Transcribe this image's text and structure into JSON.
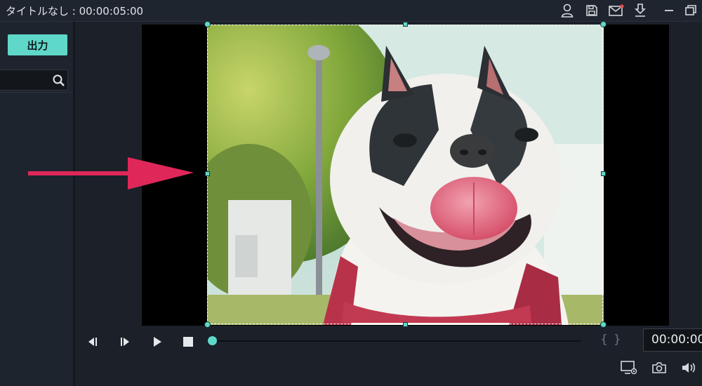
{
  "window": {
    "title": "タイトルなし : 00:00:05:00",
    "icons": [
      "account-icon",
      "save-icon",
      "mail-icon",
      "download-icon",
      "minimize-icon",
      "restore-icon"
    ],
    "notification_color": "#e84a4a"
  },
  "left_panel": {
    "export_label": "出力",
    "search": {
      "value": "",
      "placeholder": ""
    }
  },
  "preview": {
    "subject": "dog-photo",
    "arrow_color": "#e0275a",
    "accent": "#5fd8c9"
  },
  "playback": {
    "controls": [
      "previous-frame",
      "next-frame",
      "play",
      "stop"
    ],
    "mark_in": "{",
    "mark_out": "}",
    "timecode": "00:00:00",
    "progress": 0
  },
  "bottom_icons": [
    "display-settings-icon",
    "snapshot-icon",
    "volume-icon"
  ]
}
